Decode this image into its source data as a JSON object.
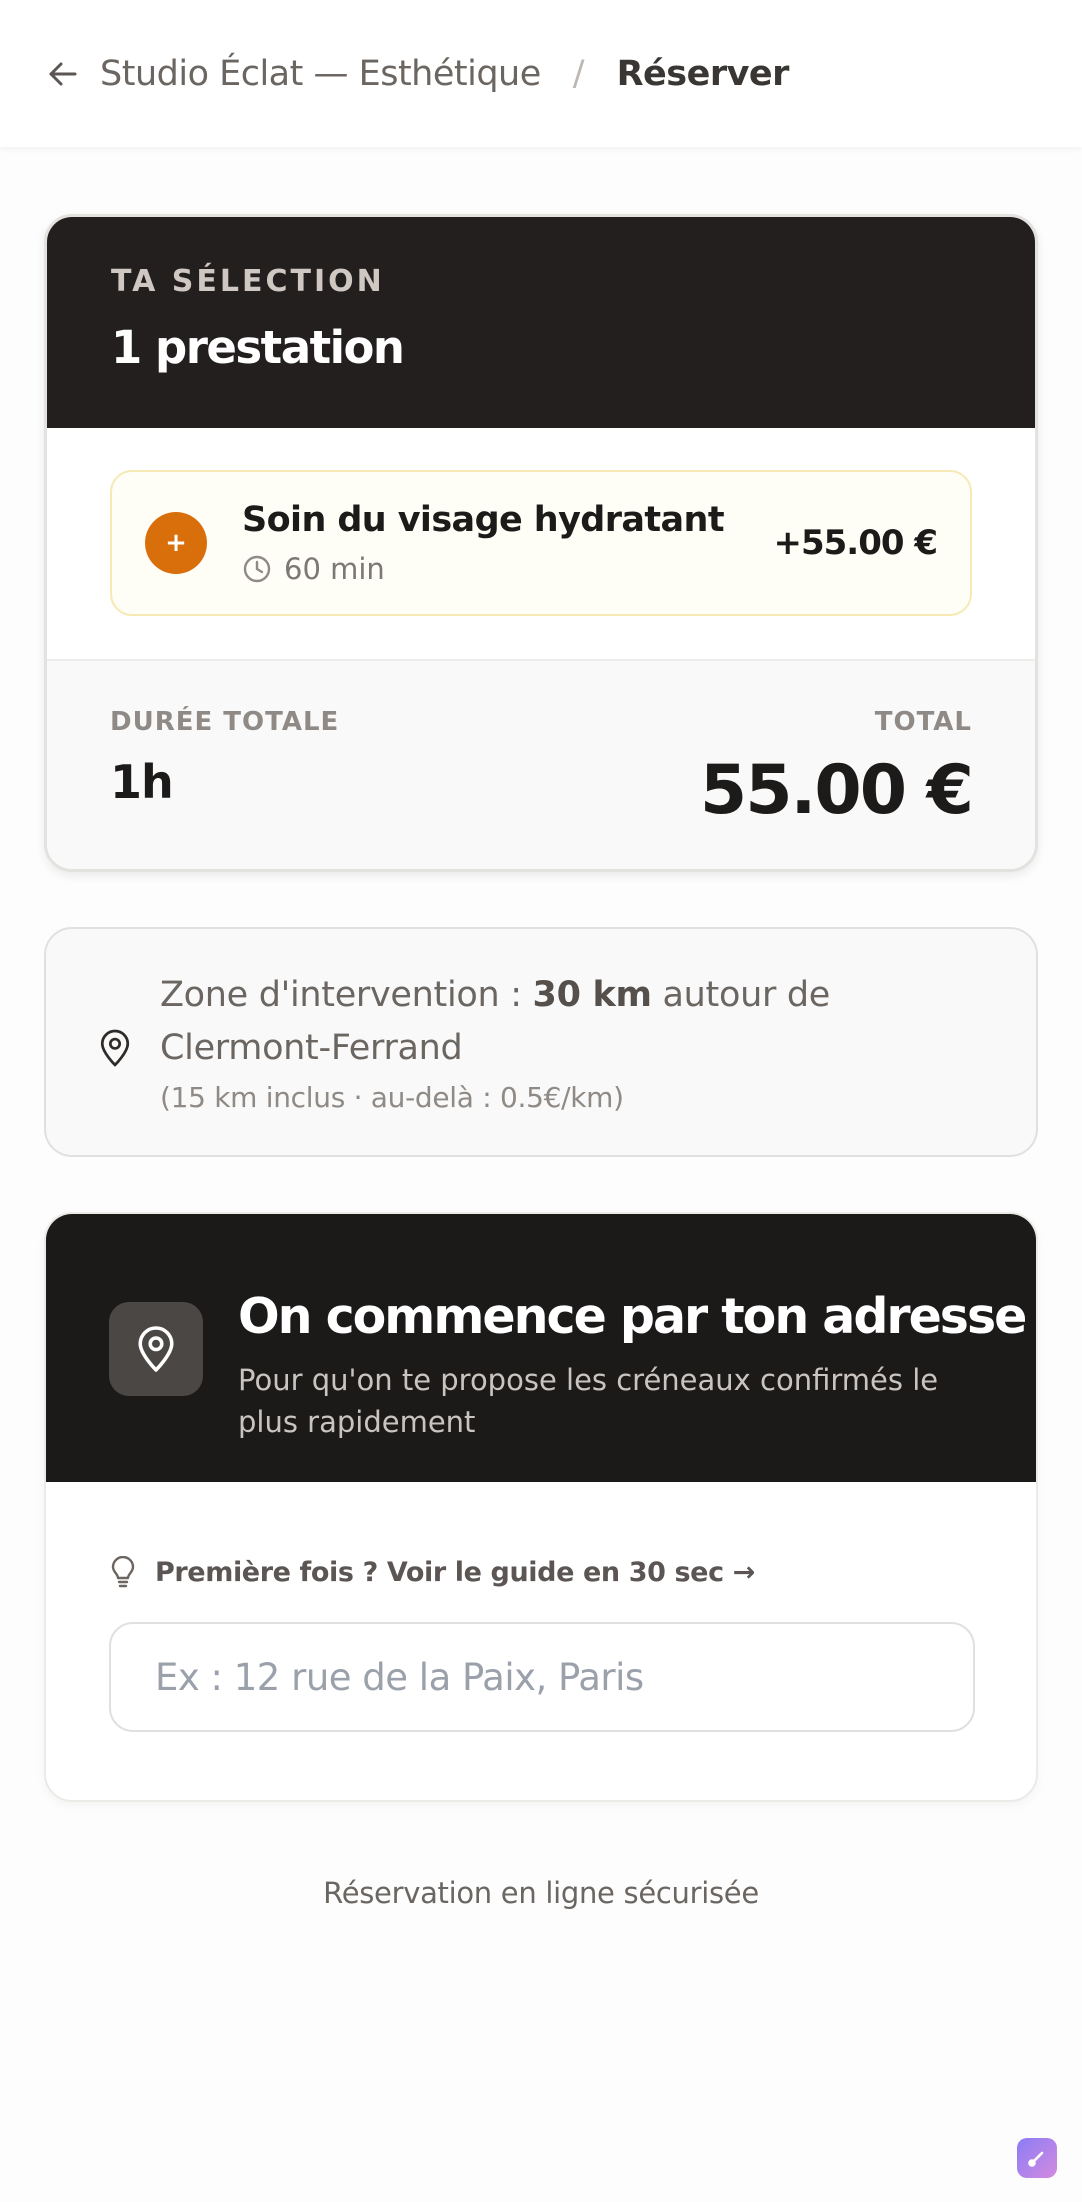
{
  "header": {
    "studio_name": "Studio Éclat — Esthétique",
    "separator": "/",
    "current_page": "Réserver"
  },
  "selection": {
    "kicker": "TA SÉLECTION",
    "count_label": "1 prestation",
    "services": [
      {
        "badge": "+",
        "name": "Soin du visage hydratant",
        "duration": "60 min",
        "price": "+55.00 €"
      }
    ],
    "duration_label": "DURÉE TOTALE",
    "duration_value": "1h",
    "total_label": "TOTAL",
    "total_value": "55.00 €"
  },
  "zone": {
    "prefix": "Zone d'intervention :",
    "distance": "30 km",
    "suffix": "autour de Clermont-Ferrand",
    "detail": "(15 km inclus · au-delà : 0.5€/km)"
  },
  "address": {
    "title": "On commence par ton adresse",
    "subtitle": "Pour qu'on te propose les créneaux confirmés le plus rapidement",
    "guide_link": "Première fois ? Voir le guide en 30 sec →",
    "input_placeholder": "Ex : 12 rue de la Paix, Paris",
    "input_value": ""
  },
  "footer": {
    "secure_text": "Réservation en ligne sécurisée"
  },
  "colors": {
    "accent_orange": "#d96f0b",
    "dark_header": "#231f1e",
    "service_bg": "#fefdf6"
  }
}
